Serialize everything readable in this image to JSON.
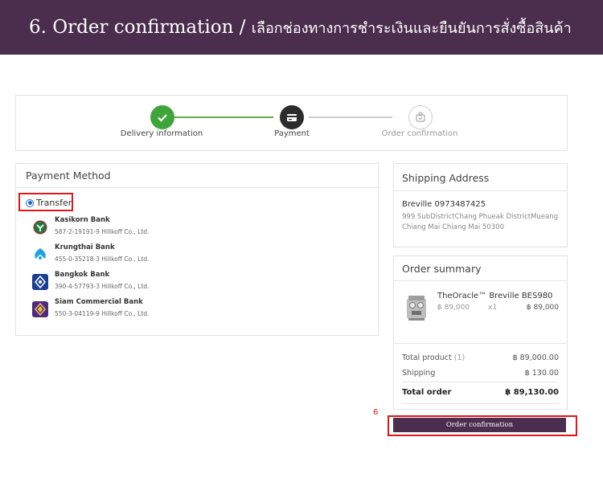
{
  "banner": {
    "title": "6. Order confirmation / ",
    "thai": "เลือกช่องทางการชำระเงินและยืนยันการสั่งซื้อสินค้า"
  },
  "steps": [
    {
      "label": "Delivery information",
      "state": "done",
      "icon": "check-icon"
    },
    {
      "label": "Payment",
      "state": "current",
      "icon": "card-icon"
    },
    {
      "label": "Order confirmation",
      "state": "pending",
      "icon": "cart-icon"
    }
  ],
  "payment": {
    "title": "Payment Method",
    "method_label": "Transfer",
    "banks": [
      {
        "name": "Kasikorn Bank",
        "account": "587-2-19191-9 Hillkoff Co., Ltd.",
        "color": "#1a7b3a"
      },
      {
        "name": "Krungthai Bank",
        "account": "455-0-35218-3 Hillkoff Co., Ltd.",
        "color": "#1ba5e1"
      },
      {
        "name": "Bangkok Bank",
        "account": "390-4-57793-3 Hillkoff Co., Ltd.",
        "color": "#1c3f94"
      },
      {
        "name": "Siam Commercial Bank",
        "account": "550-3-04119-9 Hillkoff Co., Ltd.",
        "color": "#4e2a84"
      }
    ]
  },
  "shipping": {
    "title": "Shipping Address",
    "name": "Breville 0973487425",
    "address_line1": "999 SubDistrictChang Phueak DistrictMueang",
    "address_line2": "Chiang Mai Chiang Mai 50300"
  },
  "summary": {
    "title": "Order summary",
    "product_name": "TheOracle™ Breville BES980",
    "product_price": "฿ 89,000",
    "product_qty": "x1",
    "product_total": "฿ 89,000",
    "total_product_label": "Total product",
    "total_product_count": "(1)",
    "total_product_value": "฿ 89,000.00",
    "shipping_label": "Shipping",
    "shipping_value": "฿ 130.00",
    "total_label": "Total order",
    "total_value": "฿ 89,130.00"
  },
  "confirm_button": "Order confirmation",
  "step_number": "6",
  "colors": {
    "brand": "#4b2d4e",
    "highlight": "#e0161b",
    "success": "#3fa53a"
  }
}
